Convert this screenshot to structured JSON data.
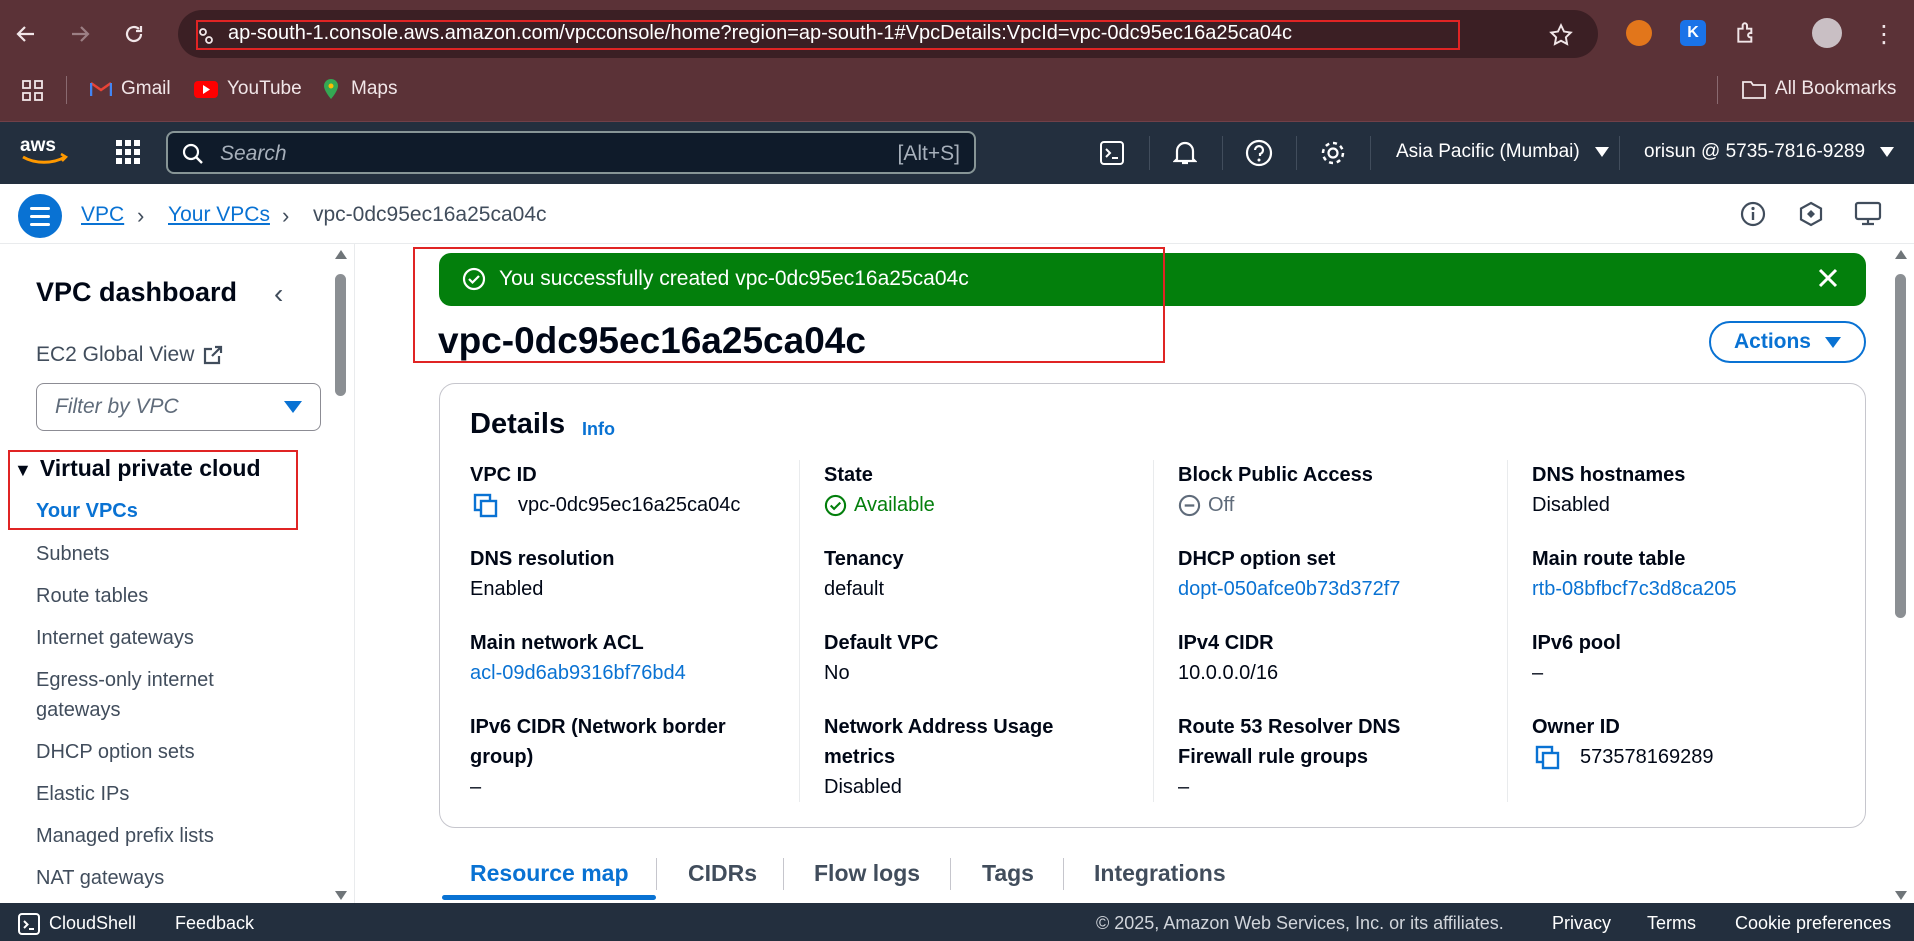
{
  "browser": {
    "url": "ap-south-1.console.aws.amazon.com/vpcconsole/home?region=ap-south-1#VpcDetails:VpcId=vpc-0dc95ec16a25ca04c",
    "bookmarks": [
      "Gmail",
      "YouTube",
      "Maps"
    ],
    "all_bookmarks": "All Bookmarks"
  },
  "aws_nav": {
    "search_placeholder": "Search",
    "search_shortcut": "[Alt+S]",
    "region": "Asia Pacific (Mumbai)",
    "account": "orisun @ 5735-7816-9289"
  },
  "breadcrumb": [
    "VPC",
    "Your VPCs",
    "vpc-0dc95ec16a25ca04c"
  ],
  "sidebar": {
    "title": "VPC dashboard",
    "ec2_global_view": "EC2 Global View",
    "filter_placeholder": "Filter by VPC",
    "section": "Virtual private cloud",
    "active_item": "Your VPCs",
    "items": [
      "Subnets",
      "Route tables",
      "Internet gateways",
      "Egress-only internet gateways",
      "DHCP option sets",
      "Elastic IPs",
      "Managed prefix lists",
      "NAT gateways"
    ]
  },
  "flash": {
    "message": "You successfully created vpc-0dc95ec16a25ca04c",
    "color": "#037f0c"
  },
  "page_title": "vpc-0dc95ec16a25ca04c",
  "actions_label": "Actions",
  "details": {
    "title": "Details",
    "info": "Info",
    "fields": [
      {
        "label": "VPC ID",
        "value": "vpc-0dc95ec16a25ca04c"
      },
      {
        "label": "State",
        "value": "Available"
      },
      {
        "label": "Block Public Access",
        "value": "Off"
      },
      {
        "label": "DNS hostnames",
        "value": "Disabled"
      },
      {
        "label": "DNS resolution",
        "value": "Enabled"
      },
      {
        "label": "Tenancy",
        "value": "default"
      },
      {
        "label": "DHCP option set",
        "value": "dopt-050afce0b73d372f7"
      },
      {
        "label": "Main route table",
        "value": "rtb-08bfbcf7c3d8ca205"
      },
      {
        "label": "Main network ACL",
        "value": "acl-09d6ab9316bf76bd4"
      },
      {
        "label": "Default VPC",
        "value": "No"
      },
      {
        "label": "IPv4 CIDR",
        "value": "10.0.0.0/16"
      },
      {
        "label": "IPv6 pool",
        "value": "–"
      },
      {
        "label": "IPv6 CIDR (Network border group)",
        "value": "–"
      },
      {
        "label": "Network Address Usage metrics",
        "value": "Disabled"
      },
      {
        "label": "Route 53 Resolver DNS Firewall rule groups",
        "value": "–"
      },
      {
        "label": "Owner ID",
        "value": "573578169289"
      }
    ]
  },
  "tabs": [
    "Resource map",
    "CIDRs",
    "Flow logs",
    "Tags",
    "Integrations"
  ],
  "footer": {
    "cloudshell": "CloudShell",
    "feedback": "Feedback",
    "copyright": "© 2025, Amazon Web Services, Inc. or its affiliates.",
    "privacy": "Privacy",
    "terms": "Terms",
    "cookies": "Cookie preferences"
  }
}
